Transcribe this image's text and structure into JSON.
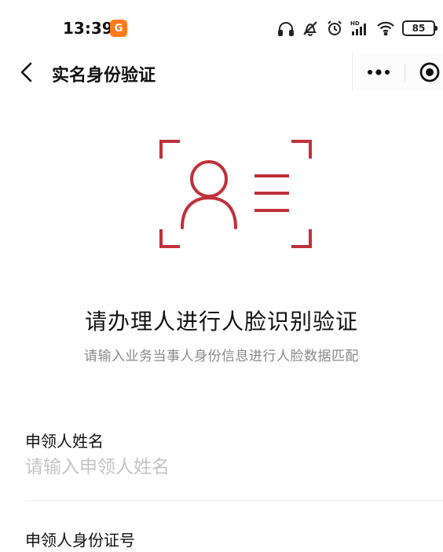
{
  "status_bar": {
    "time": "13:39",
    "app_badge": "G",
    "battery": "85",
    "icons": [
      "headphones-icon",
      "alarm-off-icon",
      "alarm-icon",
      "signal-hd-icon",
      "wifi-icon",
      "battery-icon"
    ]
  },
  "nav": {
    "title": "实名身份验证",
    "back_icon": "chevron-left-icon",
    "more_icon": "more-dots-icon",
    "close_icon": "target-close-icon"
  },
  "illustration": {
    "icon": "face-id-icon",
    "color": "#c0313a"
  },
  "heading": {
    "title": "请办理人进行人脸识别验证",
    "subtitle": "请输入业务当事人身份信息进行人脸数据匹配"
  },
  "form": {
    "name_label": "申领人姓名",
    "name_placeholder": "请输入申领人姓名",
    "name_value": "",
    "id_label": "申领人身份证号"
  },
  "colors": {
    "accent": "#c0313a",
    "placeholder": "#c4c4c4",
    "secondary_text": "#8a8a8a",
    "badge": "#ff7a1a"
  }
}
